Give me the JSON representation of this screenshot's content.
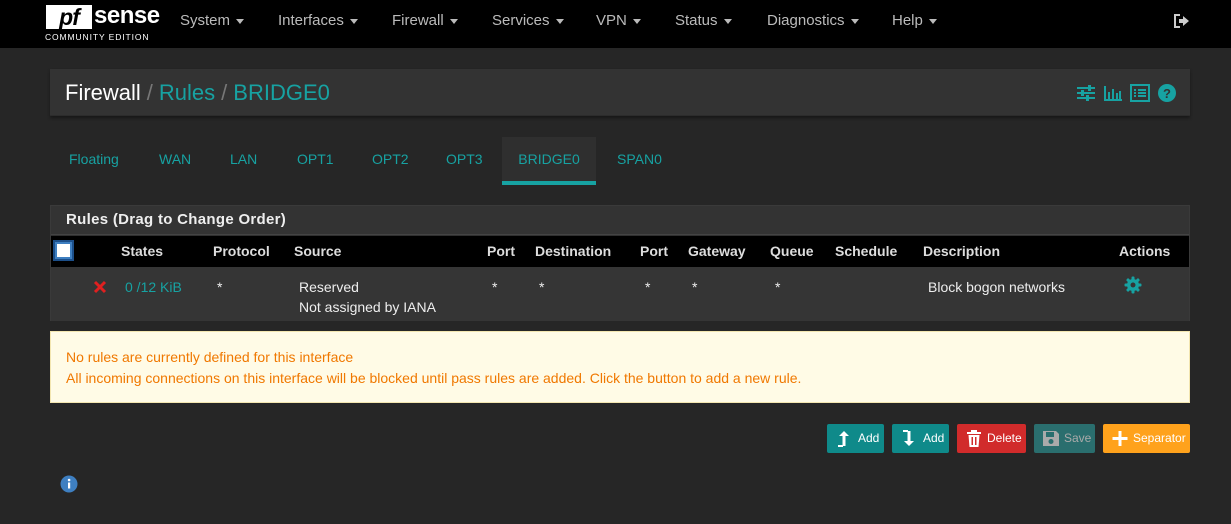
{
  "navbar": {
    "logo_pf": "pf",
    "logo_sense": "sense",
    "logo_edition": "COMMUNITY EDITION",
    "items": [
      "System",
      "Interfaces",
      "Firewall",
      "Services",
      "VPN",
      "Status",
      "Diagnostics",
      "Help"
    ],
    "logout_icon": "sign-out-icon"
  },
  "breadcrumb": {
    "root": "Firewall",
    "separator": "/",
    "rules": "Rules",
    "current": "BRIDGE0",
    "icons": [
      "sliders-icon",
      "bar-chart-icon",
      "list-icon",
      "help-icon"
    ]
  },
  "tabs": [
    {
      "label": "Floating"
    },
    {
      "label": "WAN"
    },
    {
      "label": "LAN"
    },
    {
      "label": "OPT1"
    },
    {
      "label": "OPT2"
    },
    {
      "label": "OPT3"
    },
    {
      "label": "BRIDGE0",
      "active": true
    },
    {
      "label": "SPAN0"
    }
  ],
  "rules_panel": {
    "title": "Rules (Drag to Change Order)",
    "columns": [
      "States",
      "Protocol",
      "Source",
      "Port",
      "Destination",
      "Port",
      "Gateway",
      "Queue",
      "Schedule",
      "Description",
      "Actions"
    ],
    "row": {
      "status_icon": "block-x-icon",
      "states": "0 /12 KiB",
      "protocol": "*",
      "source_line1": "Reserved",
      "source_line2": "Not assigned by IANA",
      "port": "*",
      "destination": "*",
      "dest_port": "*",
      "gateway": "*",
      "queue": "*",
      "schedule": "",
      "description": "Block bogon networks",
      "action_icon": "gear-icon"
    }
  },
  "alert": {
    "line1": "No rules are currently defined for this interface",
    "line2": "All incoming connections on this interface will be blocked until pass rules are added. Click the button to add a new rule."
  },
  "buttons": {
    "add_top": "Add",
    "add_bottom": "Add",
    "delete": "Delete",
    "save": "Save",
    "separator": "Separator"
  },
  "colors": {
    "accent": "#17a2a2",
    "navbar": "#000000",
    "danger": "#d12b2b",
    "warning": "#ffa21c",
    "alert_text": "#f07800"
  }
}
